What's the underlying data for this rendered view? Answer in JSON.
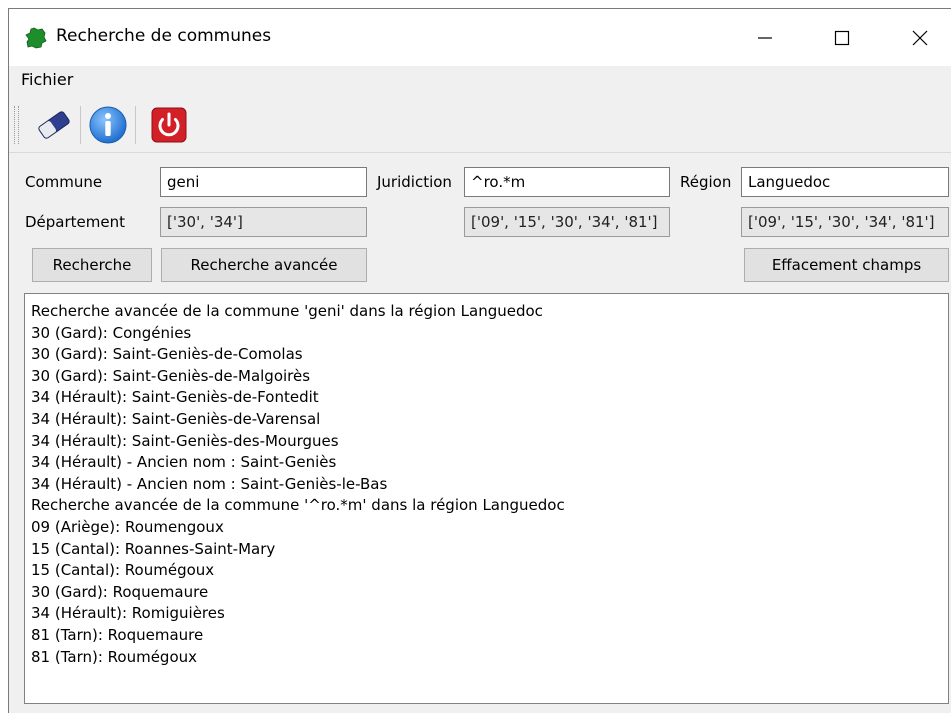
{
  "window": {
    "title": "Recherche de communes",
    "minimize": "—",
    "maximize": "☐",
    "close": "✕"
  },
  "menu": [
    {
      "label": "Fichier"
    }
  ],
  "toolbar": [
    {
      "name": "eraser-icon"
    },
    {
      "name": "info-icon"
    },
    {
      "name": "power-icon"
    }
  ],
  "form": {
    "commune_label": "Commune",
    "commune_value": "geni",
    "juridiction_label": "Juridiction",
    "juridiction_value": "^ro.*m",
    "region_label": "Région",
    "region_value": "Languedoc",
    "departement_label": "Département",
    "departement_commune": "['30', '34']",
    "departement_juridiction": "['09', '15', '30', '34', '81']",
    "departement_region": "['09', '15', '30', '34', '81']"
  },
  "buttons": {
    "recherche": "Recherche",
    "recherche_avancee": "Recherche avancée",
    "effacement": "Effacement champs"
  },
  "output": [
    "Recherche avancée de la commune 'geni' dans la région Languedoc",
    "30 (Gard): Congénies",
    "30 (Gard): Saint-Geniès-de-Comolas",
    "30 (Gard): Saint-Geniès-de-Malgoirès",
    "34 (Hérault): Saint-Geniès-de-Fontedit",
    "34 (Hérault): Saint-Geniès-de-Varensal",
    "34 (Hérault): Saint-Geniès-des-Mourgues",
    "34 (Hérault) - Ancien nom : Saint-Geniès",
    "34 (Hérault) - Ancien nom : Saint-Geniès-le-Bas",
    "Recherche avancée de la commune '^ro.*m' dans la région Languedoc",
    "09 (Ariège): Roumengoux",
    "15 (Cantal): Roannes-Saint-Mary",
    "15 (Cantal): Roumégoux",
    "30 (Gard): Roquemaure",
    "34 (Hérault): Romiguières",
    "81 (Tarn): Roquemaure",
    "81 (Tarn): Roumégoux"
  ],
  "colors": {
    "app_icon": "#1e8e2c",
    "info": "#2a7fd6",
    "power": "#d32027",
    "panel": "#f0f0f0"
  }
}
